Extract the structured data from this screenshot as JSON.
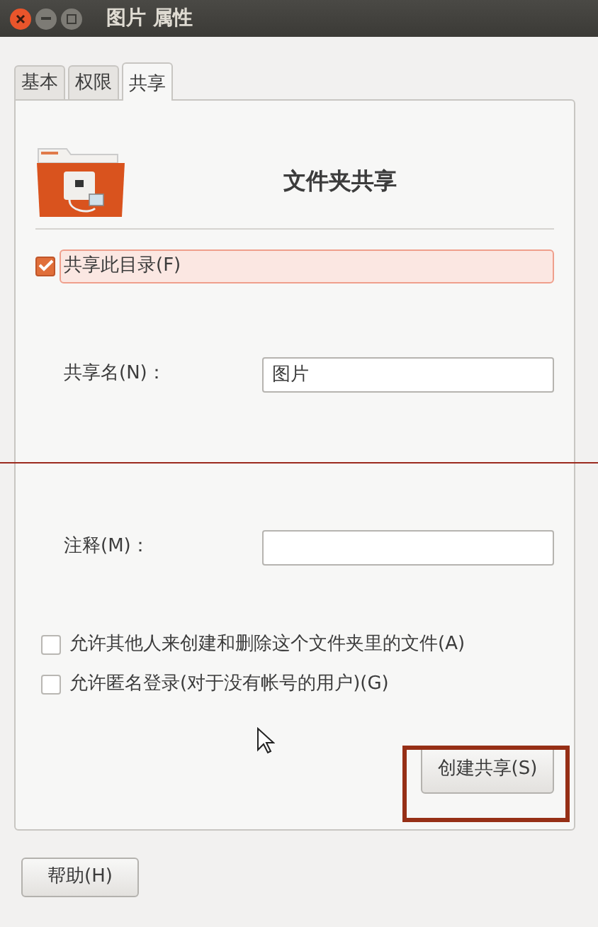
{
  "window": {
    "title": "图片 属性"
  },
  "tabs": [
    {
      "label": "基本",
      "selected": false
    },
    {
      "label": "权限",
      "selected": false
    },
    {
      "label": "共享",
      "selected": true
    }
  ],
  "header": {
    "title": "文件夹共享"
  },
  "share_checkbox": {
    "label": "共享此目录(F)",
    "checked": true,
    "focused": true
  },
  "fields": [
    {
      "label": "共享名(N)：",
      "value": "图片"
    },
    {
      "label": "注释(M)："
    }
  ],
  "options": [
    {
      "label": "允许其他人来创建和删除这个文件夹里的文件(A)",
      "checked": false
    },
    {
      "label": "允许匿名登录(对于没有帐号的用户)(G)",
      "checked": false
    }
  ],
  "create_button": "创建共享(S)",
  "help_button": "帮助(H)"
}
